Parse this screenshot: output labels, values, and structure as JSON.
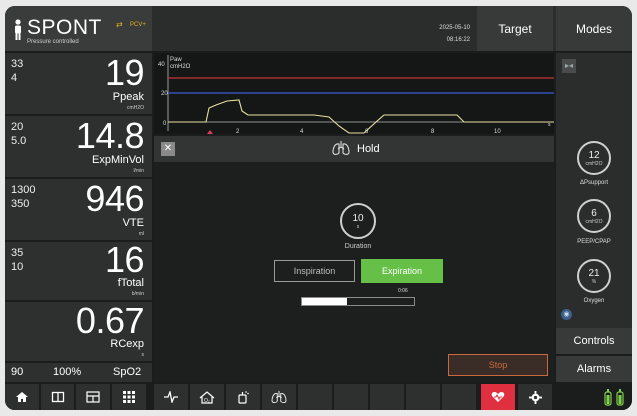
{
  "header": {
    "mode": "SPONT",
    "mode_subtitle": "Pressure controlled",
    "vent_mode": "PCV+",
    "date": "2025-05-10",
    "time": "08:16:22",
    "target_label": "Target",
    "modes_label": "Modes"
  },
  "params": [
    {
      "hi": "33",
      "lo": "4",
      "value": "19",
      "label": "Ppeak",
      "unit": "cmH2O"
    },
    {
      "hi": "20",
      "lo": "5.0",
      "value": "14.8",
      "label": "ExpMinVol",
      "unit": "l/min"
    },
    {
      "hi": "1300",
      "lo": "350",
      "value": "946",
      "label": "VTE",
      "unit": "ml"
    },
    {
      "hi": "35",
      "lo": "10",
      "value": "16",
      "label": "fTotal",
      "unit": "b/min"
    },
    {
      "hi": "",
      "lo": "",
      "value": "0.67",
      "label": "RCexp",
      "unit": "s"
    }
  ],
  "spo2": {
    "low": "90",
    "high": "100%",
    "label": "SpO2"
  },
  "waveform": {
    "label": "Paw",
    "unit": "cmH2O",
    "y_ticks": [
      "40",
      "20",
      "0"
    ],
    "x_ticks": [
      "2",
      "4",
      "6",
      "8",
      "10"
    ],
    "x_unit": "s"
  },
  "hold": {
    "title": "Hold",
    "close_label": "✕",
    "duration_value": "10",
    "duration_unit": "s",
    "duration_label": "Duration",
    "inspiration_label": "Inspiration",
    "expiration_label": "Expiration",
    "progress_time": "0:06",
    "progress_fraction": 0.4,
    "stop_label": "Stop"
  },
  "controls": [
    {
      "value": "12",
      "unit": "cmH2O",
      "label": "ΔPsupport"
    },
    {
      "value": "6",
      "unit": "cmH2O",
      "label": "PEEP/CPAP"
    },
    {
      "value": "21",
      "unit": "%",
      "label": "Oxygen"
    }
  ],
  "right": {
    "controls_label": "Controls",
    "alarms_label": "Alarms"
  },
  "colors": {
    "accent_green": "#66bf47",
    "stop_orange": "#c86a3e",
    "alarm_red": "#e03040",
    "limit_red": "#c8323a",
    "limit_blue": "#3b5bd6",
    "wave_yellow": "#e8e0a0"
  }
}
